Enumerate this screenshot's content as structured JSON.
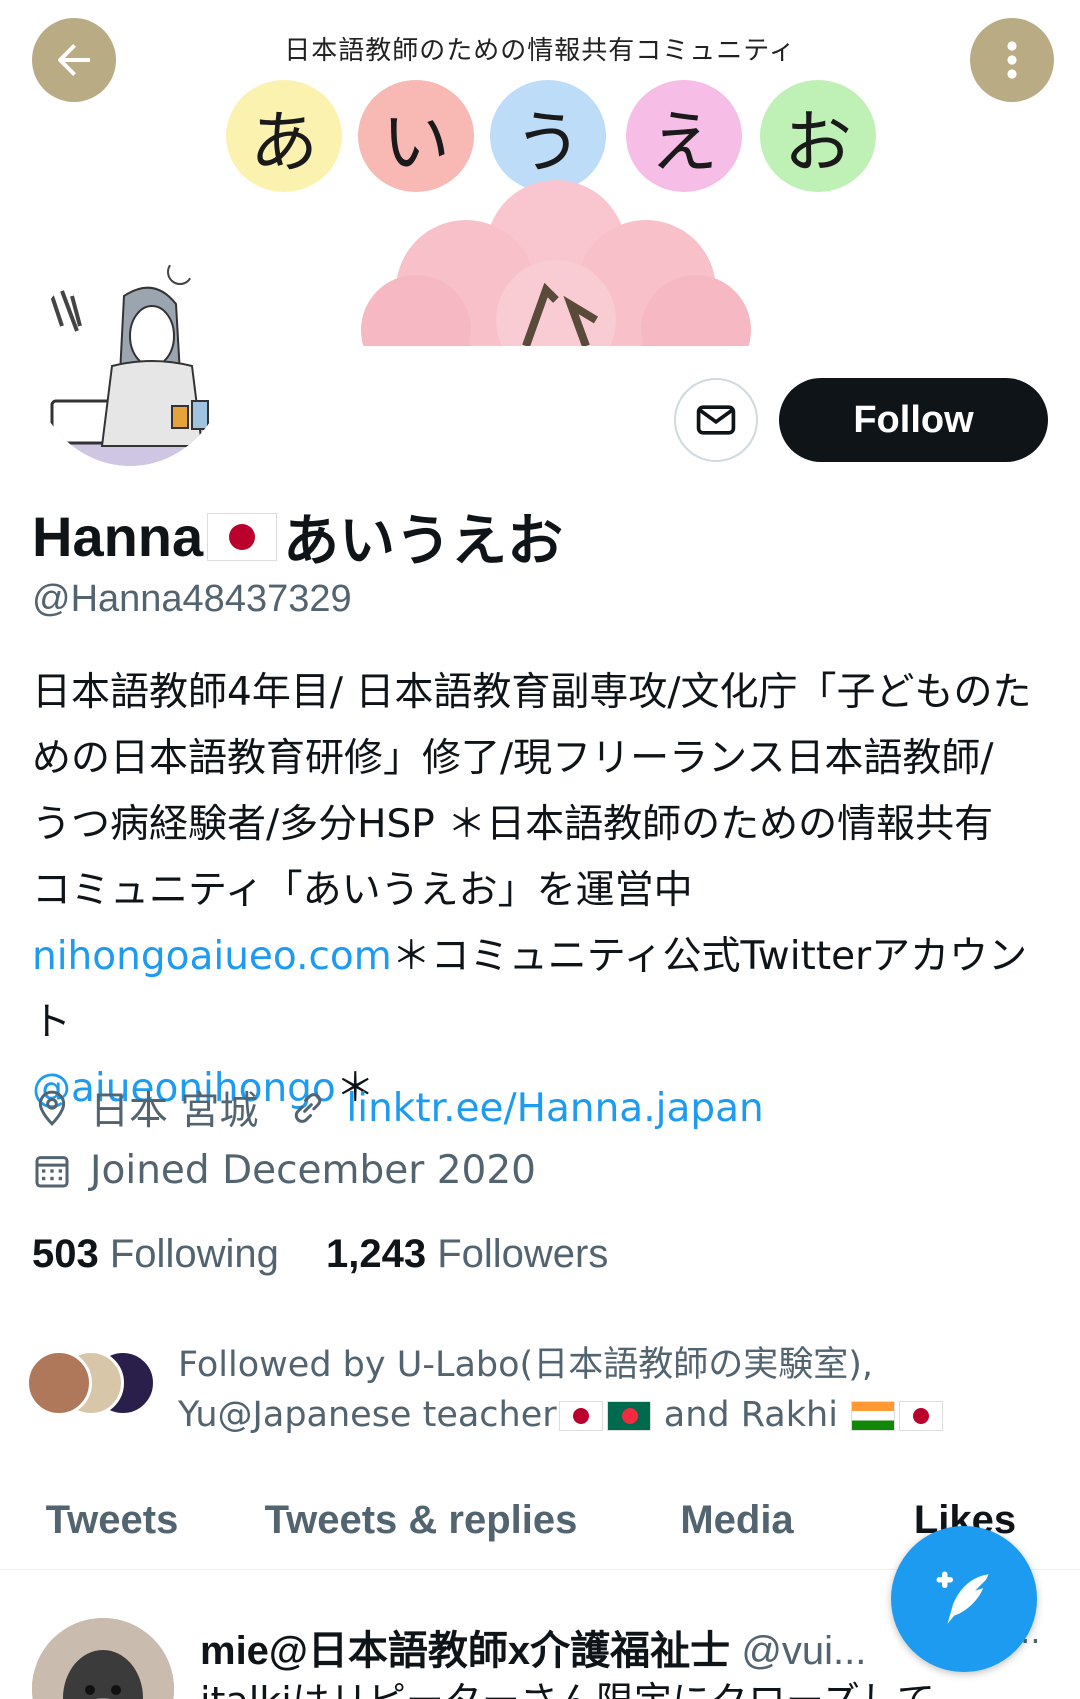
{
  "banner": {
    "title": "日本語教師のための情報共有コミュニティ",
    "kana": [
      {
        "char": "あ",
        "color": "#fbf2b0"
      },
      {
        "char": "い",
        "color": "#f8b9b4"
      },
      {
        "char": "う",
        "color": "#bcdcf7"
      },
      {
        "char": "え",
        "color": "#f6bde6"
      },
      {
        "char": "お",
        "color": "#bff0b5"
      }
    ]
  },
  "header": {
    "back_icon": "arrow-left-icon",
    "more_icon": "more-vertical-icon",
    "button_color": "#b9ab83"
  },
  "profile": {
    "name_prefix": "Hanna",
    "name_suffix": "あいうえお",
    "handle": "@Hanna48437329",
    "message_icon": "envelope-icon",
    "follow_label": "Follow"
  },
  "bio": {
    "text_1": "日本語教師4年目/ 日本語教育副専攻/文化庁「子どものための日本語教育研修」修了/現フリーランス日本語教師/うつ病経験者/多分HSP ＊日本語教師のための情報共有コミュニティ「あいうえお」を運営中",
    "link_1": "nihongoaiueo.com",
    "text_2": "＊コミュニティ公式Twitterアカウント",
    "link_2": "@aiueonihongo",
    "text_3": "＊"
  },
  "meta": {
    "location": "日本 宮城",
    "website": "linktr.ee/Hanna.japan",
    "joined": "Joined December 2020"
  },
  "stats": {
    "following_count": "503",
    "following_label": "Following",
    "followers_count": "1,243",
    "followers_label": "Followers"
  },
  "followed_by": {
    "line_1": "Followed by U-Labo(日本語教師の実験室),",
    "line_2_a": "Yu@Japanese teacher",
    "line_2_b": " and Rakhi "
  },
  "tabs": [
    {
      "label": "Tweets"
    },
    {
      "label": "Tweets & replies"
    },
    {
      "label": "Media"
    },
    {
      "label": "Likes"
    }
  ],
  "tweet": {
    "author": "mie@日本語教師x介護福祉士",
    "handle": "@vui...",
    "more": "···",
    "text": "italkiはリピーターさん限定にクローズして"
  },
  "fab": {
    "icon": "compose-feather-icon"
  },
  "colors": {
    "accent": "#1d9bf0",
    "text": "#0f1419",
    "muted": "#536471"
  }
}
